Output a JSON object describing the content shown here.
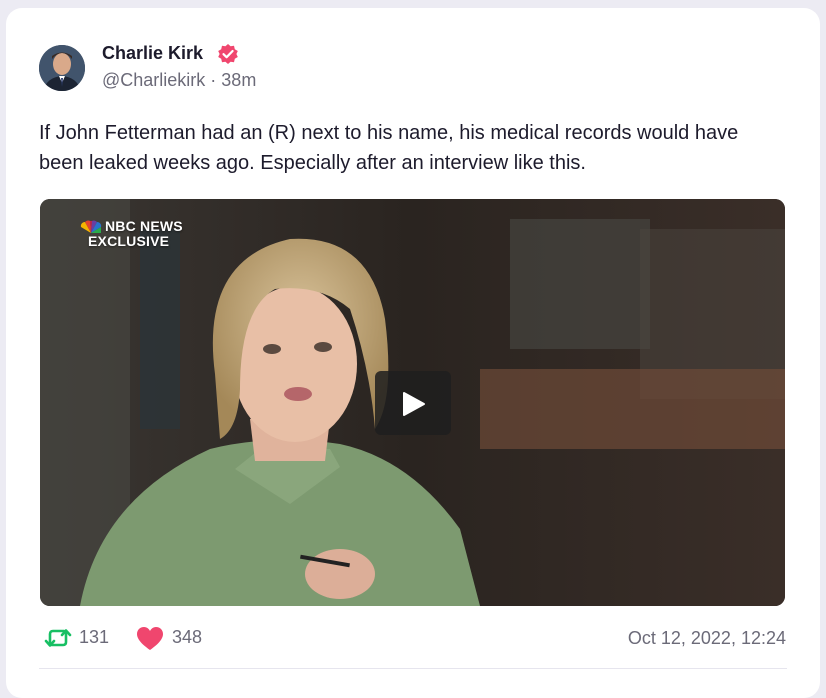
{
  "author": {
    "name": "Charlie Kirk",
    "handle": "@Charliekirk",
    "time": "38m",
    "verified": true
  },
  "post": {
    "text": "If John Fetterman had an (R) next to his name, his medical records would have been leaked weeks ago. Especially after an interview like this."
  },
  "video": {
    "watermark_line1": "NBC NEWS",
    "watermark_line2": "EXCLUSIVE"
  },
  "actions": {
    "retweets": "131",
    "likes": "348",
    "date": "Oct 12, 2022, 12:24"
  },
  "icons": {
    "retweet": "retweet-icon",
    "like": "heart-icon",
    "verified": "verified-badge-icon",
    "play": "play-icon",
    "nbc": "peacock-logo"
  },
  "colors": {
    "retweet": "#17bf63",
    "like": "#f0466e",
    "verified": "#f0466e",
    "text": "#1d1b2c",
    "muted": "#6b6a78"
  }
}
